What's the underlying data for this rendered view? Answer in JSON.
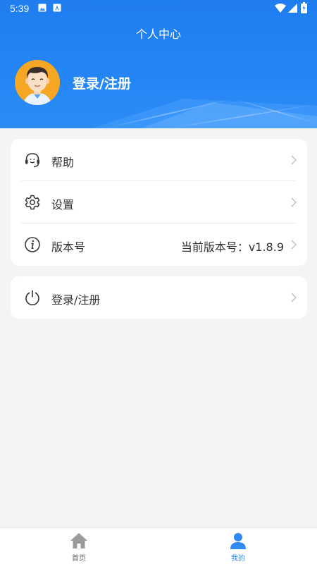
{
  "status_bar": {
    "time": "5:39"
  },
  "header": {
    "title": "个人中心",
    "login_label": "登录/注册"
  },
  "menu": {
    "help_label": "帮助",
    "settings_label": "设置",
    "version_label": "版本号",
    "version_value": "当前版本号：v1.8.9"
  },
  "login_row": {
    "label": "登录/注册"
  },
  "tabbar": {
    "home_label": "首页",
    "mine_label": "我的"
  },
  "colors": {
    "primary": "#1f7df0",
    "tab_active": "#2f8af5",
    "tab_inactive": "#999999"
  },
  "icons": {
    "help": "headset-icon",
    "settings": "gear-icon",
    "version": "info-icon",
    "login": "power-icon",
    "home": "house-icon",
    "mine": "person-icon"
  }
}
